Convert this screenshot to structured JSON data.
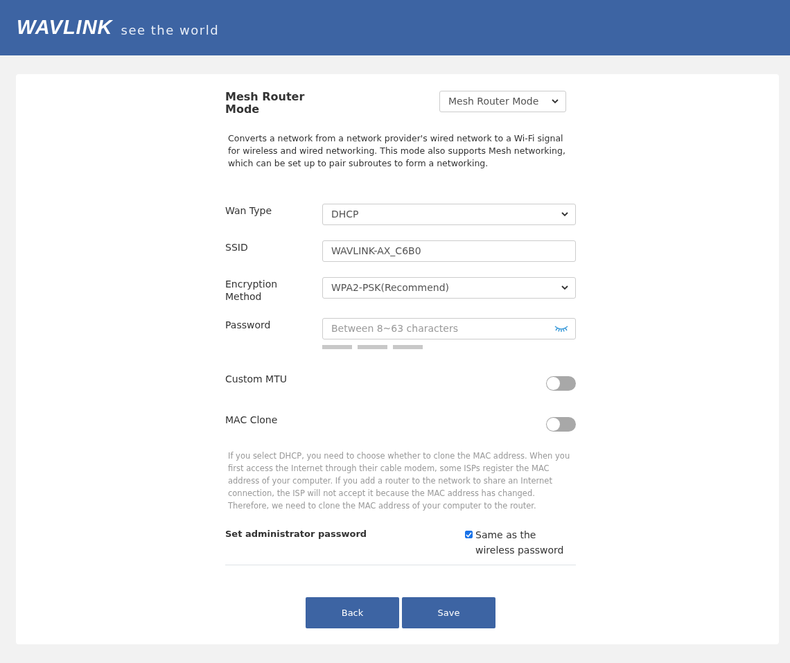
{
  "header": {
    "logo": "WAVLINK",
    "slogan": "see the world"
  },
  "mode": {
    "title": "Mesh Router Mode",
    "value": "Mesh Router Mode",
    "description": "Converts a network from a network provider's wired network to a Wi-Fi signal for wireless and wired networking. This mode also supports Mesh networking, which can be set up to pair subroutes to form a networking."
  },
  "fields": [
    {
      "kind": "select",
      "label": "Wan Type",
      "value": "DHCP"
    },
    {
      "kind": "text",
      "label": "SSID",
      "value": "WAVLINK-AX_C6B0"
    },
    {
      "kind": "select",
      "label": "Encryption Method",
      "value": "WPA2-PSK(Recommend)"
    },
    {
      "kind": "password",
      "label": "Password",
      "placeholder": "Between 8~63 characters"
    }
  ],
  "toggles": [
    {
      "label": "Custom MTU",
      "on": false
    },
    {
      "label": "MAC Clone",
      "on": false
    }
  ],
  "mac_note": "If you select DHCP, you need to choose whether to clone the MAC address. When you first access the Internet through their cable modem, some ISPs register the MAC address of your computer. If you add a router to the network to share an Internet connection, the ISP will not accept it because the MAC address has changed. Therefore, we need to clone the MAC address of your computer to the router.",
  "admin": {
    "label": "Set administrator password",
    "checkbox_label": "Same as the wireless password",
    "checked": true
  },
  "buttons": [
    "Back",
    "Save"
  ]
}
